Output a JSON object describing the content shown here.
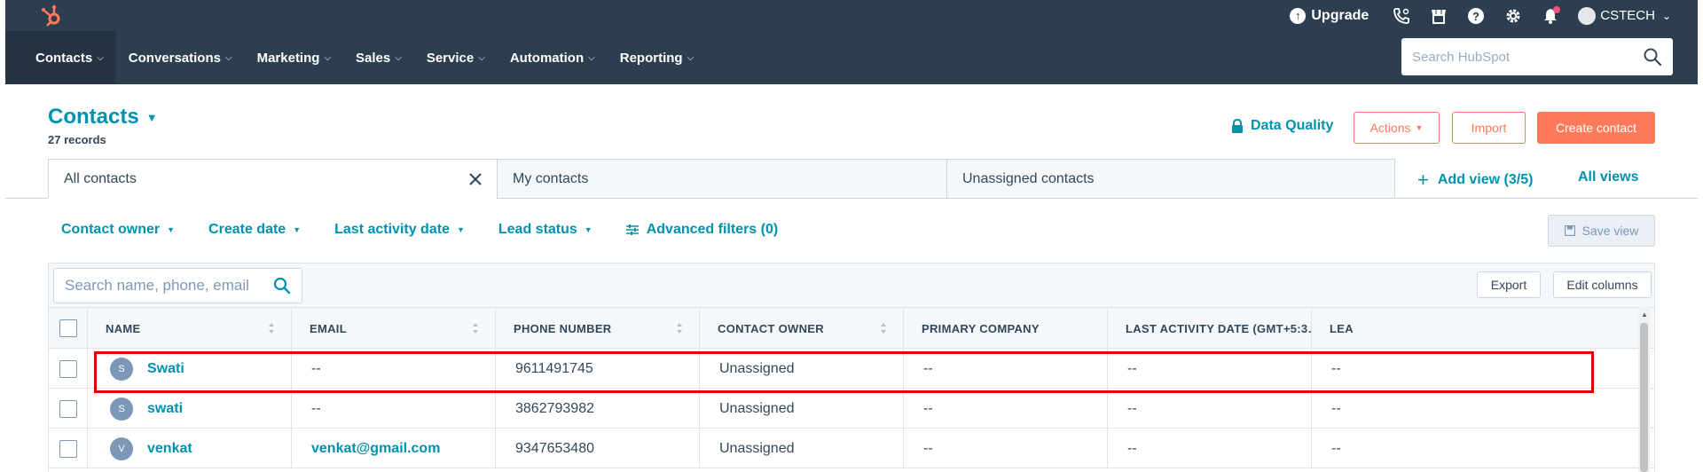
{
  "colors": {
    "nav_bg": "#2d3e50",
    "accent_link": "#0091ae",
    "cta_orange": "#ff7a59",
    "highlight_red": "#e40000"
  },
  "topbar": {
    "upgrade_label": "Upgrade",
    "account_name": "CSTECH",
    "icons": [
      "hubspot-logo",
      "calling-icon",
      "marketplace-icon",
      "help-icon",
      "settings-icon",
      "notifications-icon"
    ]
  },
  "nav": {
    "items": [
      {
        "label": "Contacts"
      },
      {
        "label": "Conversations"
      },
      {
        "label": "Marketing"
      },
      {
        "label": "Sales"
      },
      {
        "label": "Service"
      },
      {
        "label": "Automation"
      },
      {
        "label": "Reporting"
      }
    ],
    "search_placeholder": "Search HubSpot"
  },
  "header": {
    "title": "Contacts",
    "record_count": "27 records",
    "data_quality_label": "Data Quality",
    "actions_label": "Actions",
    "import_label": "Import",
    "create_label": "Create contact"
  },
  "views": {
    "tabs": [
      {
        "label": "All contacts"
      },
      {
        "label": "My contacts"
      },
      {
        "label": "Unassigned contacts"
      }
    ],
    "add_view_label": "Add view (3/5)",
    "all_views_label": "All views"
  },
  "filters": {
    "items": [
      {
        "label": "Contact owner"
      },
      {
        "label": "Create date"
      },
      {
        "label": "Last activity date"
      },
      {
        "label": "Lead status"
      }
    ],
    "advanced_label": "Advanced filters (0)",
    "save_view_label": "Save view"
  },
  "table": {
    "search_placeholder": "Search name, phone, email",
    "export_label": "Export",
    "edit_columns_label": "Edit columns",
    "columns": [
      "NAME",
      "EMAIL",
      "PHONE NUMBER",
      "CONTACT OWNER",
      "PRIMARY COMPANY",
      "LAST ACTIVITY DATE (GMT+5:3…",
      "LEA"
    ],
    "rows": [
      {
        "initial": "S",
        "name": "Swati",
        "email": "--",
        "phone": "9611491745",
        "owner": "Unassigned",
        "company": "--",
        "last_activity": "--",
        "lead": "--"
      },
      {
        "initial": "S",
        "name": "swati",
        "email": "--",
        "phone": "3862793982",
        "owner": "Unassigned",
        "company": "--",
        "last_activity": "--",
        "lead": "--"
      },
      {
        "initial": "V",
        "name": "venkat",
        "email": "venkat@gmail.com",
        "phone": "9347653480",
        "owner": "Unassigned",
        "company": "--",
        "last_activity": "--",
        "lead": "--"
      }
    ]
  }
}
